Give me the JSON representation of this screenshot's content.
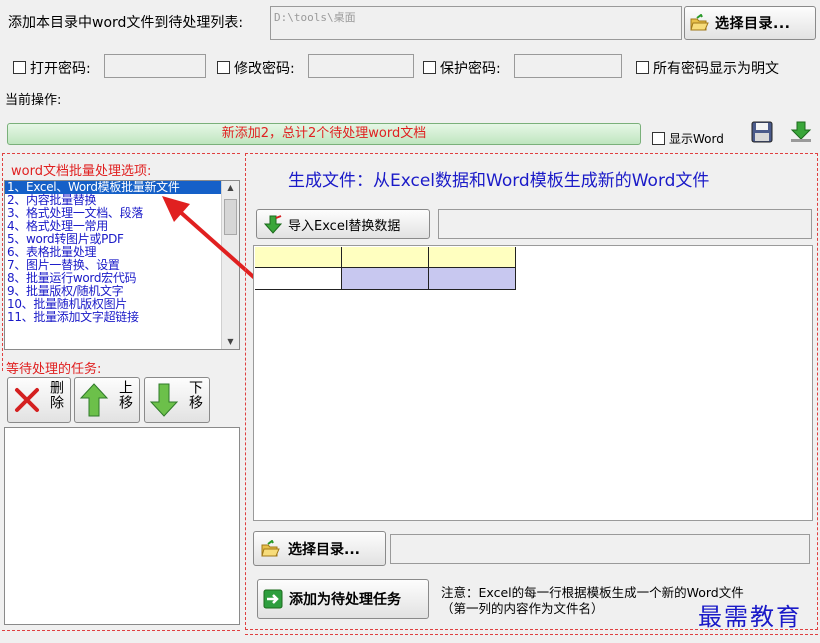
{
  "top": {
    "add_label": "添加本目录中word文件到待处理列表:",
    "path_value": "D:\\tools\\桌面",
    "choose_dir": "选择目录..."
  },
  "passwords": {
    "open": "打开密码:",
    "modify": "修改密码:",
    "protect": "保护密码:",
    "show_plain": "所有密码显示为明文"
  },
  "current_op_label": "当前操作:",
  "status": {
    "text": "新添加2，总计2个待处理word文档",
    "show_word": "显示Word"
  },
  "options": {
    "title": "word文档批量处理选项:",
    "items": [
      "1、Excel、Word模板批量新文件",
      "2、内容批量替换",
      "3、格式处理一文档、段落",
      "4、格式处理一常用",
      "5、word转图片或PDF",
      "6、表格批量处理",
      "7、图片一替换、设置",
      "8、批量运行word宏代码",
      "9、批量版权/随机文字",
      "10、批量随机版权图片",
      "11、批量添加文字超链接"
    ],
    "selected_index": 0
  },
  "tasks": {
    "title": "等待处理的任务:",
    "delete": "删除",
    "up": "上移",
    "down": "下移"
  },
  "panel": {
    "heading": "生成文件：从Excel数据和Word模板生成新的Word文件",
    "import_btn": "导入Excel替换数据",
    "choose_dir": "选择目录...",
    "add_task": "添加为待处理任务",
    "note_line1": "注意：Excel的每一行根据模板生成一个新的Word文件",
    "note_line2": "（第一列的内容作为文件名）"
  },
  "watermark": "最需教育",
  "colors": {
    "accent_red": "#e02020",
    "status_green": "#cdeccd",
    "selection_blue": "#1560c8",
    "heading_blue": "#1a1ac8",
    "grid_yellow": "#ffffc0",
    "grid_purple": "#c8c8f0"
  }
}
